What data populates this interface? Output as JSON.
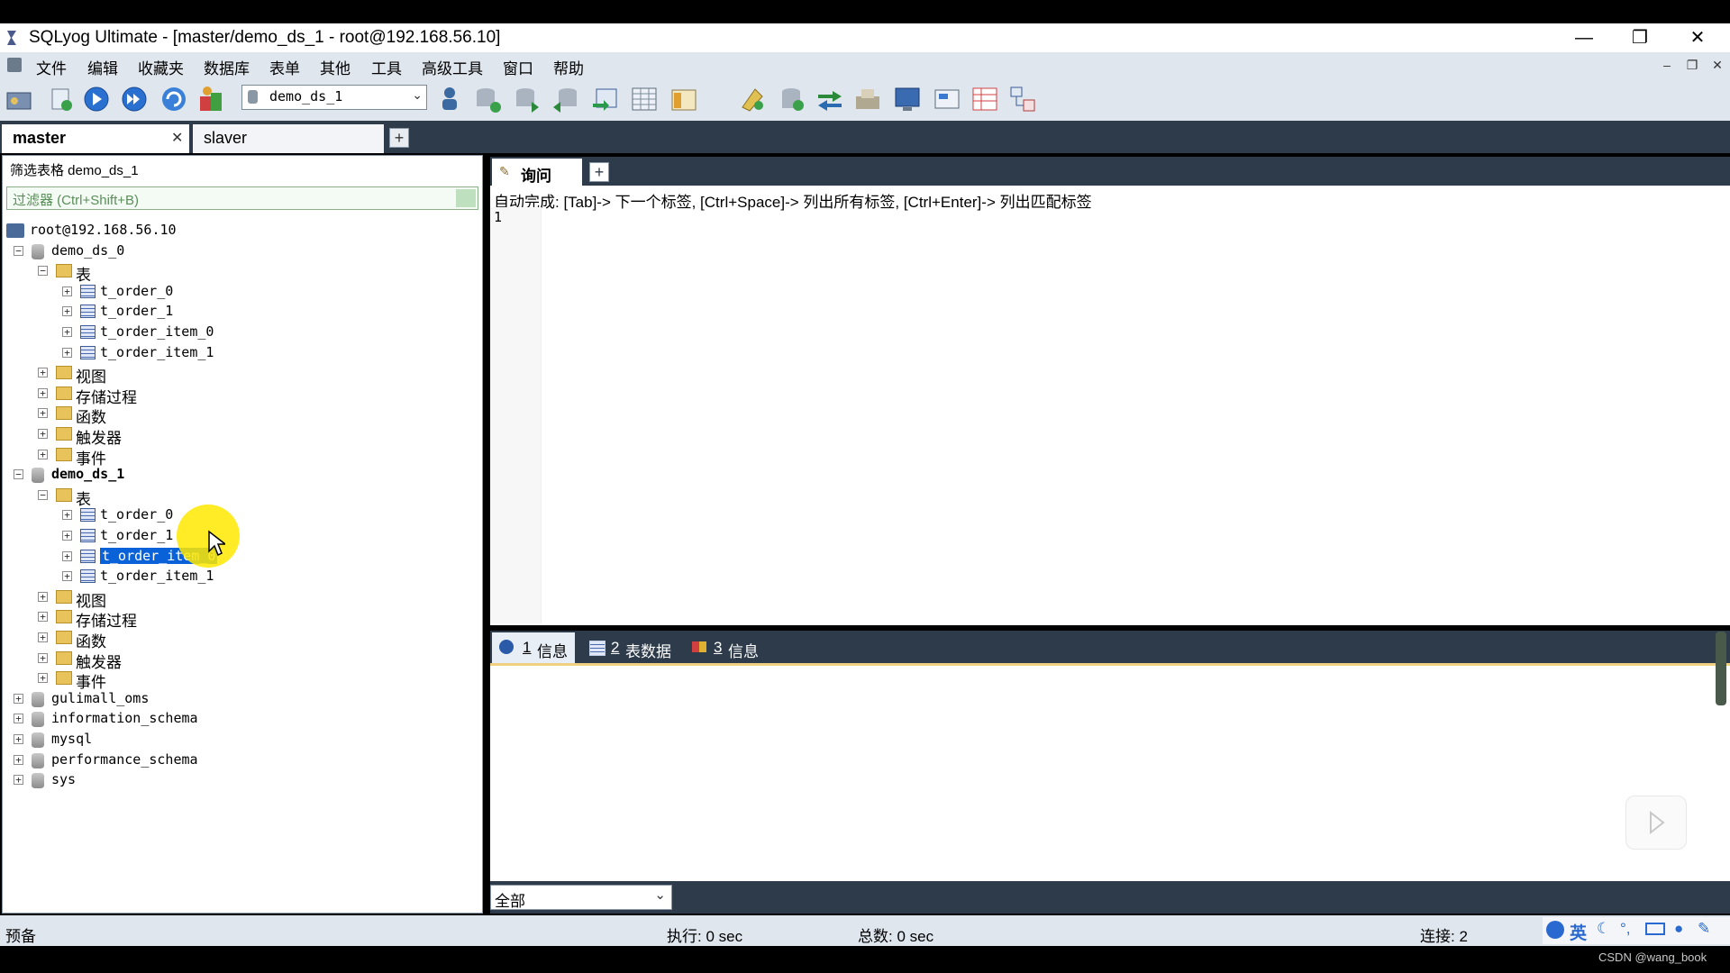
{
  "window": {
    "title": "SQLyog Ultimate - [master/demo_ds_1 - root@192.168.56.10]",
    "controls": {
      "minimize": "—",
      "restore": "❐",
      "close": "✕"
    }
  },
  "menu": [
    "文件",
    "编辑",
    "收藏夹",
    "数据库",
    "表单",
    "其他",
    "工具",
    "高级工具",
    "窗口",
    "帮助"
  ],
  "mdi_controls": {
    "minimize": "–",
    "restore": "❐",
    "close": "✕"
  },
  "toolbar": {
    "database_select": "demo_ds_1"
  },
  "connection_tabs": [
    {
      "label": "master",
      "active": true,
      "close": "✕"
    },
    {
      "label": "slaver",
      "active": false
    }
  ],
  "add_tab": "+",
  "browser": {
    "filter_title": "筛选表格 demo_ds_1",
    "filter_placeholder": "过滤器 (Ctrl+Shift+B)",
    "tree": [
      {
        "label": "root@192.168.56.10",
        "level": 0,
        "icon": "server-icon",
        "expander": ""
      },
      {
        "label": "demo_ds_0",
        "level": 1,
        "icon": "database-icon",
        "expander": "−"
      },
      {
        "label": "表",
        "level": 2,
        "icon": "folder-icon",
        "expander": "−"
      },
      {
        "label": "t_order_0",
        "level": 3,
        "icon": "table-icon",
        "expander": "+"
      },
      {
        "label": "t_order_1",
        "level": 3,
        "icon": "table-icon",
        "expander": "+"
      },
      {
        "label": "t_order_item_0",
        "level": 3,
        "icon": "table-icon",
        "expander": "+"
      },
      {
        "label": "t_order_item_1",
        "level": 3,
        "icon": "table-icon",
        "expander": "+"
      },
      {
        "label": "视图",
        "level": 2,
        "icon": "folder-icon",
        "expander": "+"
      },
      {
        "label": "存储过程",
        "level": 2,
        "icon": "folder-icon",
        "expander": "+"
      },
      {
        "label": "函数",
        "level": 2,
        "icon": "folder-icon",
        "expander": "+"
      },
      {
        "label": "触发器",
        "level": 2,
        "icon": "folder-icon",
        "expander": "+"
      },
      {
        "label": "事件",
        "level": 2,
        "icon": "folder-icon",
        "expander": "+"
      },
      {
        "label": "demo_ds_1",
        "level": 1,
        "icon": "database-icon",
        "expander": "−",
        "bold": true
      },
      {
        "label": "表",
        "level": 2,
        "icon": "folder-icon",
        "expander": "−"
      },
      {
        "label": "t_order_0",
        "level": 3,
        "icon": "table-icon",
        "expander": "+"
      },
      {
        "label": "t_order_1",
        "level": 3,
        "icon": "table-icon",
        "expander": "+"
      },
      {
        "label": "t_order_item_0",
        "level": 3,
        "icon": "table-icon",
        "expander": "+",
        "selected": true
      },
      {
        "label": "t_order_item_1",
        "level": 3,
        "icon": "table-icon",
        "expander": "+"
      },
      {
        "label": "视图",
        "level": 2,
        "icon": "folder-icon",
        "expander": "+"
      },
      {
        "label": "存储过程",
        "level": 2,
        "icon": "folder-icon",
        "expander": "+"
      },
      {
        "label": "函数",
        "level": 2,
        "icon": "folder-icon",
        "expander": "+"
      },
      {
        "label": "触发器",
        "level": 2,
        "icon": "folder-icon",
        "expander": "+"
      },
      {
        "label": "事件",
        "level": 2,
        "icon": "folder-icon",
        "expander": "+"
      },
      {
        "label": "gulimall_oms",
        "level": 1,
        "icon": "database-icon",
        "expander": "+"
      },
      {
        "label": "information_schema",
        "level": 1,
        "icon": "database-icon",
        "expander": "+"
      },
      {
        "label": "mysql",
        "level": 1,
        "icon": "database-icon",
        "expander": "+"
      },
      {
        "label": "performance_schema",
        "level": 1,
        "icon": "database-icon",
        "expander": "+"
      },
      {
        "label": "sys",
        "level": 1,
        "icon": "database-icon",
        "expander": "+"
      }
    ]
  },
  "query": {
    "tab_label": "询问",
    "autocomplete_hint": "自动完成: [Tab]-> 下一个标签, [Ctrl+Space]-> 列出所有标签, [Ctrl+Enter]-> 列出匹配标签",
    "line_number": "1"
  },
  "results": {
    "tabs": [
      {
        "num": "1",
        "label": "信息",
        "icon": "info-icon"
      },
      {
        "num": "2",
        "label": "表数据",
        "icon": "table-data-icon"
      },
      {
        "num": "3",
        "label": "信息",
        "icon": "info-colored-icon"
      }
    ],
    "filter_select": "全部"
  },
  "status": {
    "left": "预备",
    "exec": "执行: 0 sec",
    "total": "总数: 0 sec",
    "connections": "连接: 2",
    "ime": "英"
  },
  "watermark": "CSDN @wang_book",
  "colors": {
    "accent": "#0a62d8",
    "chrome": "#dfe6ee",
    "dark_bar": "#2e3b4a"
  }
}
